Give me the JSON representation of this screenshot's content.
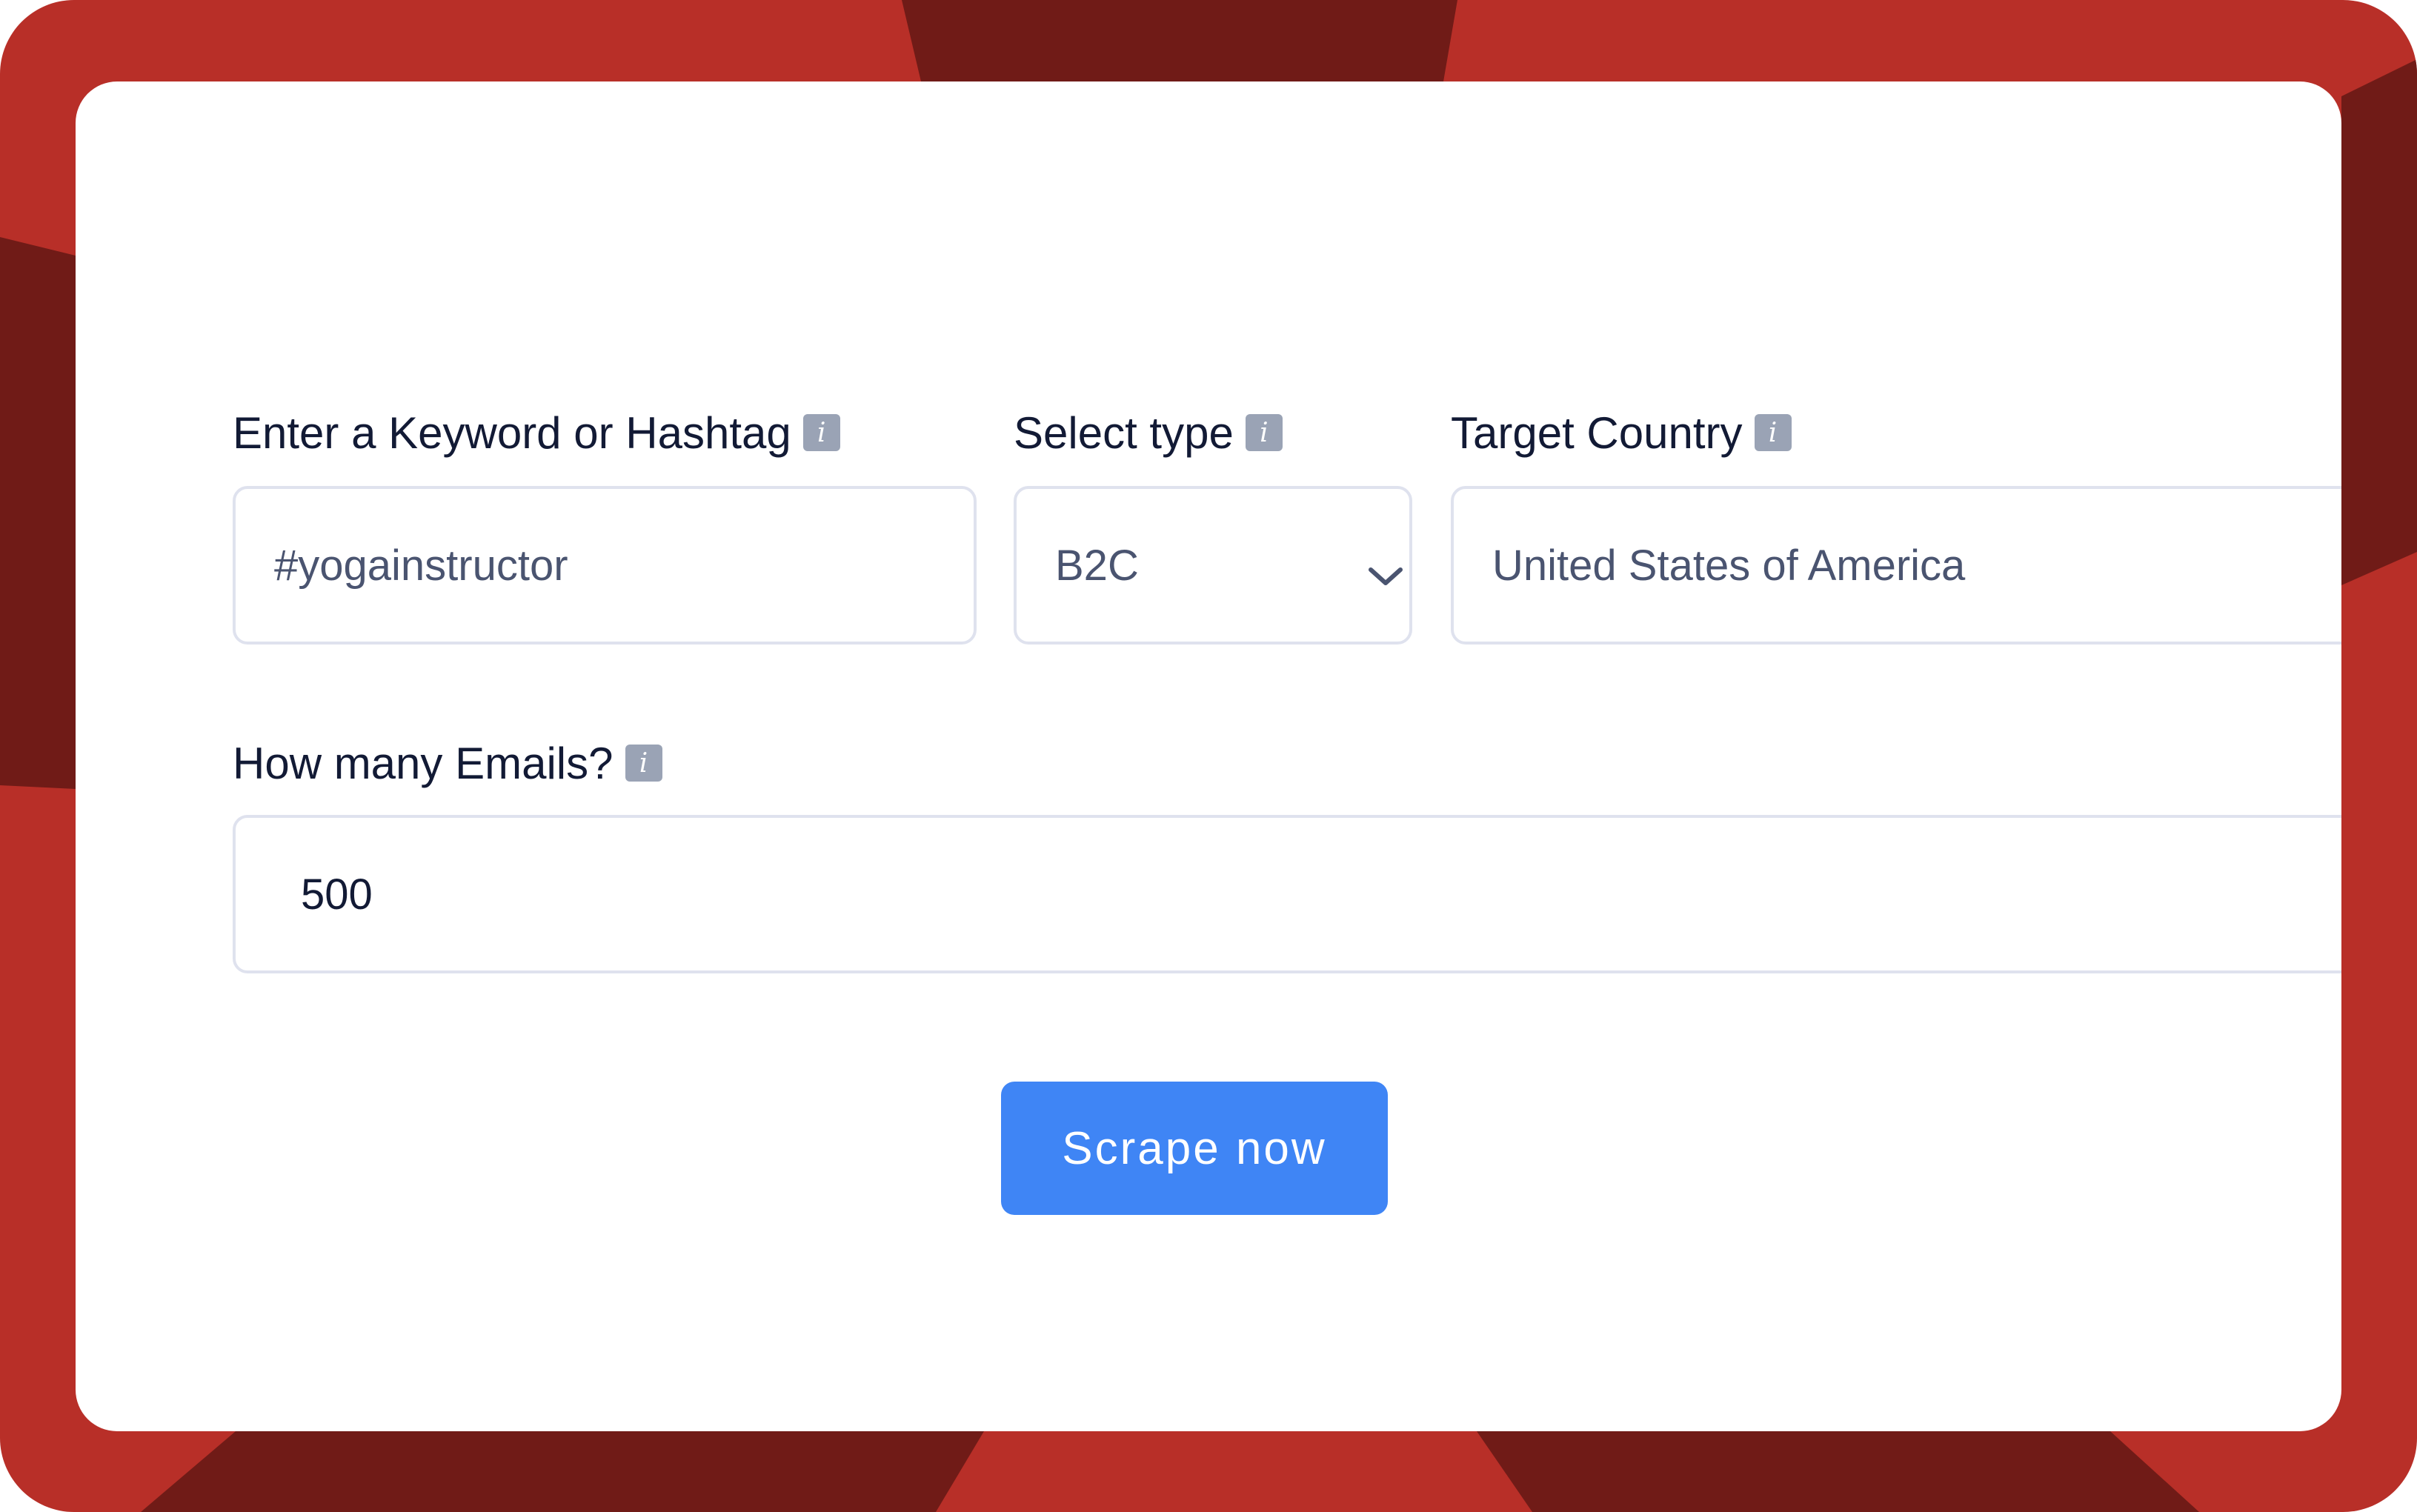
{
  "form": {
    "keyword": {
      "label": "Enter a Keyword or Hashtag",
      "value": "#yogainstructor"
    },
    "type": {
      "label": "Select type",
      "selected": "B2C"
    },
    "country": {
      "label": "Target Country",
      "value": "United States of America"
    },
    "emails": {
      "label": "How many Emails?",
      "value": "500"
    },
    "submit_label": "Scrape now",
    "info_glyph": "i"
  },
  "icons": {
    "info": "info-icon",
    "dropdown": "chevron-down-icon"
  },
  "colors": {
    "frame_red": "#b82f28",
    "frame_dark": "#701b17",
    "button_blue": "#3f85f5",
    "info_badge": "#9aa3b5"
  }
}
